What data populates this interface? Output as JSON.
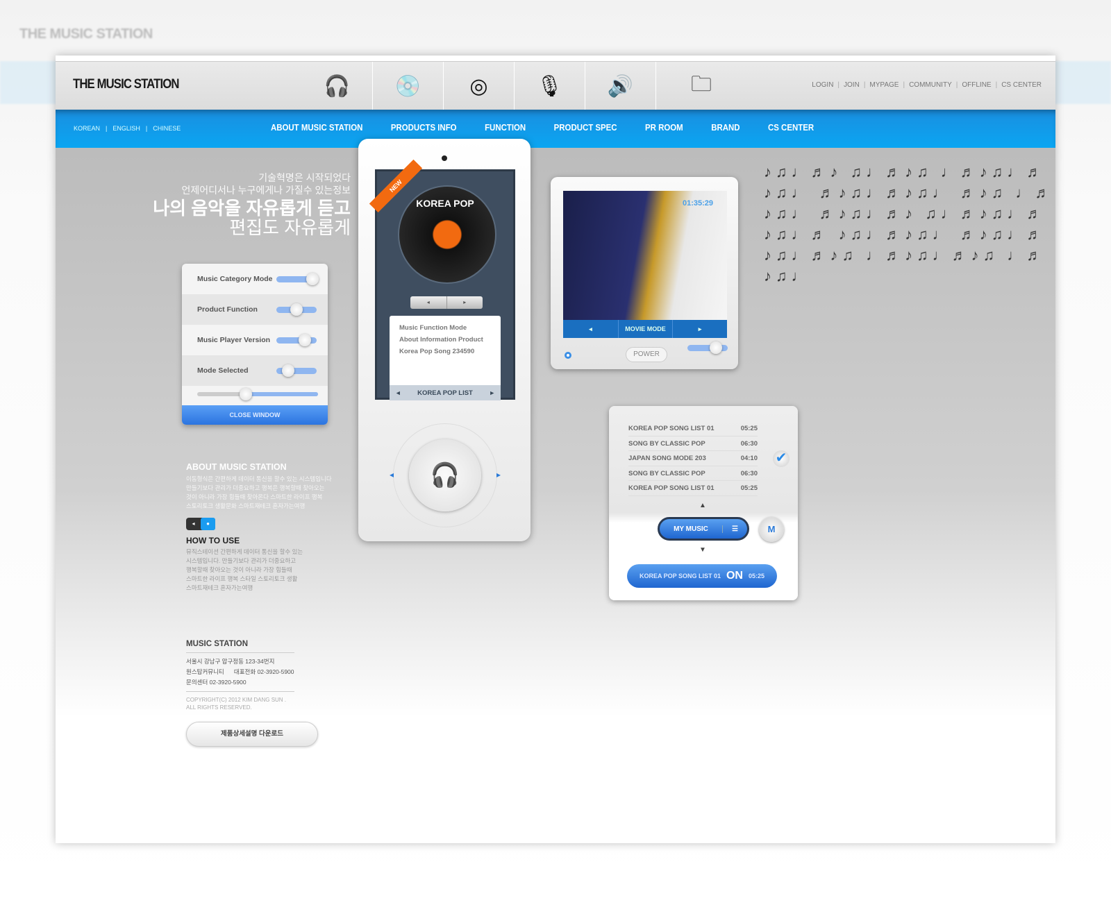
{
  "brand": {
    "title": "THE MUSIC STATION"
  },
  "header": {
    "icons": [
      "headphones-icon",
      "disc-note-icon",
      "speaker-disc-icon",
      "microphone-icon",
      "volume-icon",
      "music-folder-icon"
    ],
    "links": [
      "LOGIN",
      "JOIN",
      "MYPAGE",
      "COMMUNITY",
      "OFFLINE",
      "CS CENTER"
    ]
  },
  "nav": {
    "languages": [
      "KOREAN",
      "ENGLISH",
      "CHINESE"
    ],
    "menu": [
      "ABOUT MUSIC STATION",
      "PRODUCTS INFO",
      "FUNCTION",
      "PRODUCT SPEC",
      "PR ROOM",
      "BRAND",
      "CS CENTER"
    ]
  },
  "hero": {
    "line1": "기술혁명은 시작되었다",
    "line2": "언제어디서나 누구에게나 가질수 있는정보",
    "line3": "나의 음악을 자유롭게 듣고",
    "line4": "편집도 자유롭게"
  },
  "settings": {
    "rows": [
      {
        "label": "Music Category Mode",
        "value": 0.9
      },
      {
        "label": "Product Function",
        "value": 0.5
      },
      {
        "label": "Music Player Version",
        "value": 0.7
      },
      {
        "label": "Mode Selected",
        "value": 0.3
      }
    ],
    "range_value": 0.4,
    "close": "CLOSE WINDOW"
  },
  "player": {
    "badge": "NEW",
    "album": "KOREA POP",
    "items": [
      "Music Function Mode",
      "About Information Product",
      "Korea Pop Song 234590"
    ],
    "list_label": "KOREA POP LIST"
  },
  "movie": {
    "time": "01:35:29",
    "mode": "MOVIE MODE",
    "power": "POWER",
    "volume": 0.7
  },
  "songs": {
    "rows": [
      {
        "title": "KOREA POP SONG LIST 01",
        "time": "05:25"
      },
      {
        "title": "SONG BY CLASSIC POP",
        "time": "06:30"
      },
      {
        "title": "JAPAN SONG MODE 203",
        "time": "04:10",
        "checked": true
      },
      {
        "title": "SONG BY CLASSIC POP",
        "time": "06:30"
      },
      {
        "title": "KOREA POP SONG LIST 01",
        "time": "05:25"
      }
    ],
    "my_music": "MY MUSIC",
    "m_button": "M",
    "now": {
      "title": "KOREA POP SONG LIST 01",
      "state": "ON",
      "time": "05:25"
    }
  },
  "about": {
    "title": "ABOUT MUSIC STATION",
    "lines": [
      "이동형식은 간편하게 데이터 통신을 할수 있는 시스템입니다",
      "만들기보다 관리가 더중요하고 행복은 행복할때 찾아오는",
      "것이 아니라 가장 힘들때 찾아온다 스마트한 라이프 행복",
      "스토리토크 생활문화 스마트재테크 혼자가는여행"
    ]
  },
  "howto": {
    "title": "HOW TO USE",
    "lines": [
      "뮤직스테이션 간편하게 데이터 통신을 할수 있는",
      "시스템입니다. 만들기보다 관리가 더중요하고",
      "행복할때 찾아오는 것이 아니라 가장 힘들때",
      "스마트한 라이프 행복 스타일 스토리토크 생활",
      "스마트재테크 혼자가는여행"
    ]
  },
  "footer": {
    "title": "MUSIC STATION",
    "address": "서울시 강남구 압구정동 123-34번지",
    "community": "원스탑커뮤니티",
    "phone_label": "대표전화",
    "phone": "02-3920-5900",
    "center": "문의센터 02-3920-5900",
    "copyright1": "COPYRIGHT(C) 2012 KIM DANG SUN .",
    "copyright2": "ALL RIGHTS RESERVED.",
    "download": "제품상세설명 다운로드"
  },
  "colors": {
    "accent": "#0a9cf0",
    "button": "#2b74e0",
    "badge": "#f26a10"
  }
}
